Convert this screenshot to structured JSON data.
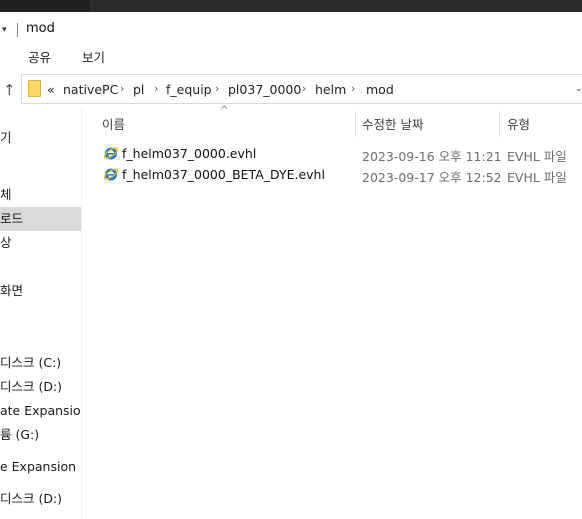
{
  "window": {
    "title": "mod",
    "quick_access_arrow": "▾"
  },
  "ribbon": {
    "tabs": [
      "공유",
      "보기"
    ]
  },
  "address_bar": {
    "overflow": "«",
    "crumbs": [
      "nativePC",
      "pl",
      "f_equip",
      "pl037_0000",
      "helm",
      "mod"
    ],
    "separator": "›",
    "dropdown": "⌄"
  },
  "nav_pane": {
    "items": [
      {
        "label": "기",
        "selected": false
      },
      {
        "label": "체",
        "selected": false
      },
      {
        "label": "로드",
        "selected": true
      },
      {
        "label": "상",
        "selected": false
      },
      {
        "label": "화면",
        "selected": false
      },
      {
        "label": "디스크 (C:)",
        "selected": false
      },
      {
        "label": "디스크 (D:)",
        "selected": false
      },
      {
        "label": "ate Expansion D",
        "selected": false
      },
      {
        "label": "륨 (G:)",
        "selected": false
      },
      {
        "label": "e Expansion Dr",
        "selected": false
      },
      {
        "label": "디스크 (D:)",
        "selected": false
      }
    ]
  },
  "file_list": {
    "columns": {
      "name": "이름",
      "date": "수정한 날짜",
      "type": "유형"
    },
    "sort_indicator": "^",
    "rows": [
      {
        "name": "f_helm037_0000.evhl",
        "date": "2023-09-16 오후 11:21",
        "type": "EVHL 파일",
        "icon": "ie-file-icon"
      },
      {
        "name": "f_helm037_0000_BETA_DYE.evhl",
        "date": "2023-09-17 오후 12:52",
        "type": "EVHL 파일",
        "icon": "ie-file-icon"
      }
    ]
  },
  "colors": {
    "selection": "#d9d9d9",
    "folder": "#ffd766",
    "ie_blue": "#1e7ad8",
    "ie_ring": "#f2b705"
  }
}
